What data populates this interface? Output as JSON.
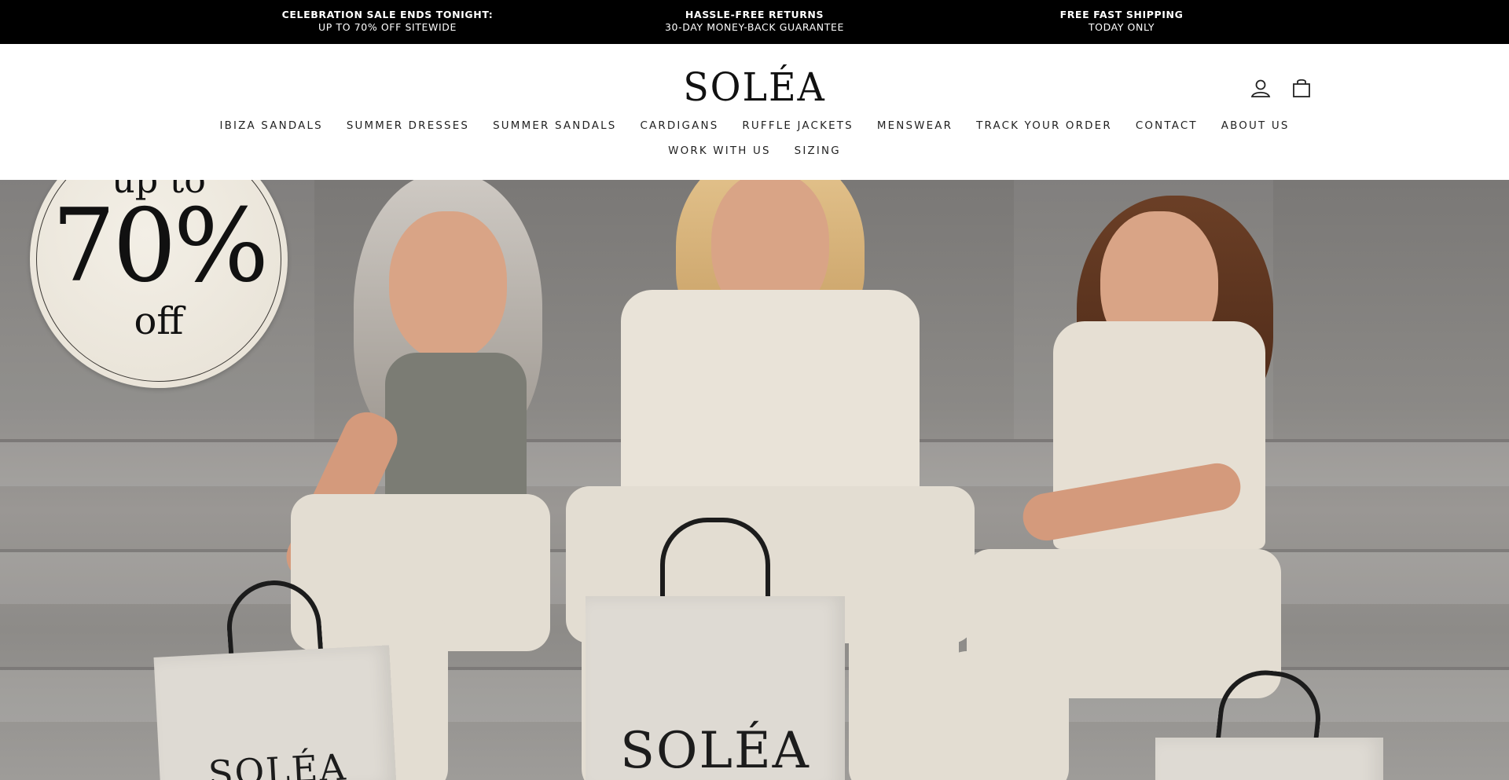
{
  "announcements": [
    {
      "title": "CELEBRATION SALE ENDS TONIGHT:",
      "subtitle": "UP TO 70% OFF SITEWIDE"
    },
    {
      "title": "HASSLE-FREE RETURNS",
      "subtitle": "30-DAY MONEY-BACK GUARANTEE"
    },
    {
      "title": "FREE FAST SHIPPING",
      "subtitle": "TODAY ONLY"
    }
  ],
  "header": {
    "logo": "SOLÉA",
    "icons": {
      "account": "user-icon",
      "cart": "shopping-bag-icon"
    }
  },
  "nav": {
    "row1": [
      "IBIZA SANDALS",
      "SUMMER DRESSES",
      "SUMMER SANDALS",
      "CARDIGANS",
      "RUFFLE JACKETS",
      "MENSWEAR",
      "TRACK YOUR ORDER",
      "CONTACT",
      "ABOUT US"
    ],
    "row2": [
      "WORK WITH US",
      "SIZING"
    ]
  },
  "hero": {
    "badge": {
      "line1": "up to",
      "line2": "70%",
      "line3": "off"
    },
    "bag_logo": "SOLÉA",
    "colors": {
      "wall": "#7a7876",
      "steps": "#9a9794",
      "outfit": "#e3ddd2"
    }
  },
  "colors": {
    "announce_bg": "#000000",
    "text": "#1a1a1a"
  }
}
